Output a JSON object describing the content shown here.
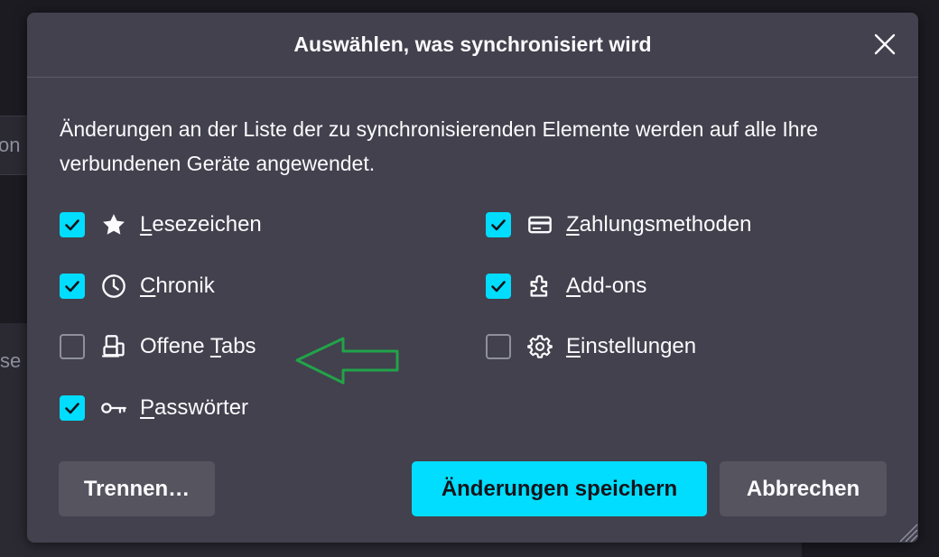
{
  "background": {
    "fragment_top": "on",
    "fragment_bottom": "se"
  },
  "dialog": {
    "title": "Auswählen, was synchronisiert wird",
    "description": "Änderungen an der Liste der zu synchronisierenden Elemente werden auf alle Ihre verbundenen Geräte angewendet.",
    "options": [
      {
        "label_pre": "",
        "label_key": "L",
        "label_post": "esezeichen",
        "checked": true,
        "icon": "star-icon"
      },
      {
        "label_pre": "",
        "label_key": "Z",
        "label_post": "ahlungsmethoden",
        "checked": true,
        "icon": "credit-card-icon"
      },
      {
        "label_pre": "",
        "label_key": "C",
        "label_post": "hronik",
        "checked": true,
        "icon": "clock-icon"
      },
      {
        "label_pre": "",
        "label_key": "A",
        "label_post": "dd-ons",
        "checked": true,
        "icon": "puzzle-icon"
      },
      {
        "label_pre": "Offene ",
        "label_key": "T",
        "label_post": "abs",
        "checked": false,
        "icon": "synced-tabs-icon"
      },
      {
        "label_pre": "",
        "label_key": "E",
        "label_post": "instellungen",
        "checked": false,
        "icon": "gear-icon"
      },
      {
        "label_pre": "",
        "label_key": "P",
        "label_post": "asswörter",
        "checked": true,
        "icon": "key-icon"
      }
    ],
    "buttons": {
      "disconnect": "Trennen…",
      "save": "Änderungen speichern",
      "cancel": "Abbrechen"
    }
  },
  "colors": {
    "accent": "#00ddff",
    "dialog_bg": "#42414d",
    "annotation_arrow": "#22a34a"
  }
}
